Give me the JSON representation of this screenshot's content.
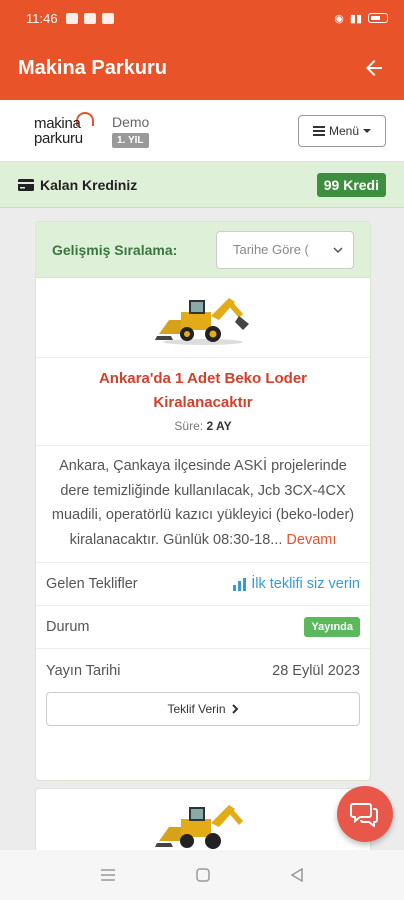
{
  "status_bar": {
    "time": "11:46"
  },
  "app_bar": {
    "title": "Makina Parkuru"
  },
  "header": {
    "logo_line1": "makina",
    "logo_line2": "parkuru",
    "demo_label": "Demo",
    "year_badge": "1. YIL",
    "menu_label": "Menü"
  },
  "credit": {
    "label": "Kalan Krediniz",
    "value": "99 Kredi"
  },
  "sorting": {
    "label": "Gelişmiş Sıralama:",
    "selected": "Tarihe Göre ("
  },
  "listing": {
    "title": "Ankara'da 1 Adet Beko Loder Kiralanacaktır",
    "duration_label": "Süre:",
    "duration_value": "2 AY",
    "description": "Ankara, Çankaya ilçesinde ASKİ projelerinde dere temizliğinde kullanılacak, Jcb 3CX-4CX muadili, operatörlü kazıcı yükleyici (beko-loder) kiralanacaktır. Günlük 08:30-18...",
    "more_label": "Devamı",
    "offers_label": "Gelen Teklifler",
    "offers_link": "İlk teklifi siz verin",
    "status_label": "Durum",
    "status_value": "Yayında",
    "date_label": "Yayın Tarihi",
    "date_value": "28 Eylül 2023",
    "offer_button": "Teklif Verin"
  },
  "colors": {
    "brand": "#e8532a",
    "success": "#3e8e3f",
    "link": "#3a9ad9",
    "title_red": "#d43f2a"
  },
  "icons": [
    "back-arrow-icon",
    "card-icon",
    "bars-chart-icon",
    "chevron-right-icon",
    "chat-icon",
    "excavator-image"
  ]
}
